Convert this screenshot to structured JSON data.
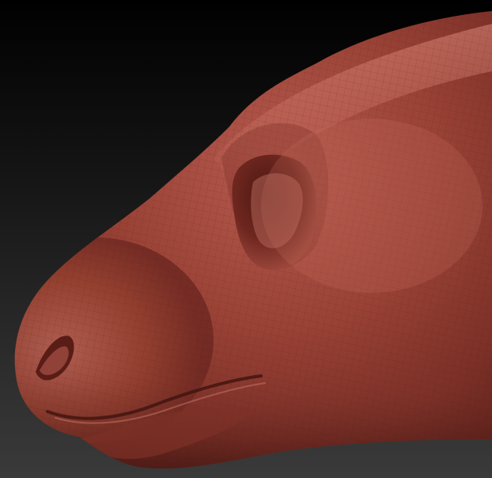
{
  "scene": {
    "subject": "sculpted-animal-head",
    "colors": {
      "background_top": "#000000",
      "background_bottom": "#3a3a3a",
      "clay_base": "#8e3a30",
      "clay_highlight": "#c76a5e",
      "clay_shadow": "#4a1914",
      "wireframe": "#5a2019"
    }
  }
}
